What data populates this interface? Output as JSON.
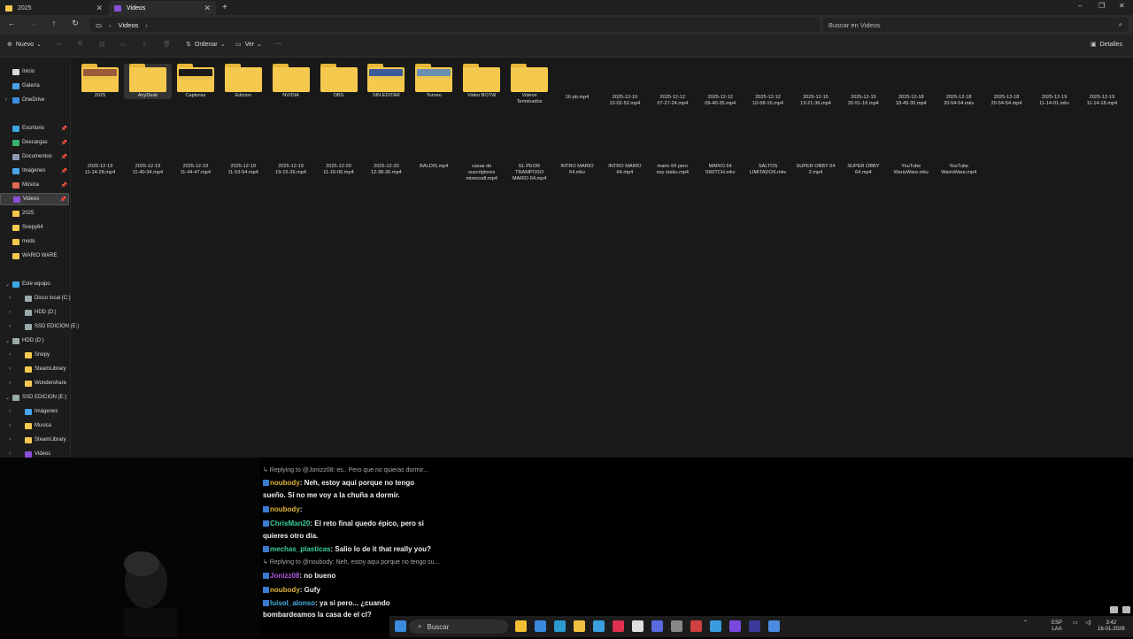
{
  "tabs": [
    {
      "label": "2025",
      "active": false
    },
    {
      "label": "Videos",
      "active": true
    }
  ],
  "window_controls": {
    "minimize": "–",
    "maximize": "❐",
    "close": "✕"
  },
  "address": {
    "path": "Videos",
    "trailing": "›"
  },
  "search": {
    "placeholder": "Buscar en Videos"
  },
  "toolbar": {
    "new_label": "Nuevo",
    "sort_label": "Ordenar",
    "view_label": "Ver",
    "more_label": "···",
    "details_label": "Detalles"
  },
  "sidebar": {
    "items": [
      {
        "label": "Inicio",
        "icon": "home-icon",
        "color": "#d8d8d8",
        "pinned": false
      },
      {
        "label": "Galería",
        "icon": "gallery-icon",
        "color": "#4aa3e8",
        "pinned": false
      },
      {
        "label": "OneDrive",
        "icon": "cloud-icon",
        "color": "#3b8ee0",
        "pinned": false
      },
      {
        "label": "Escritorio",
        "icon": "desktop-icon",
        "color": "#3fa7e6",
        "pinned": true
      },
      {
        "label": "Descargas",
        "icon": "download-icon",
        "color": "#39b36b",
        "pinned": true
      },
      {
        "label": "Documentos",
        "icon": "documents-icon",
        "color": "#8a9bb0",
        "pinned": true
      },
      {
        "label": "Imágenes",
        "icon": "pictures-icon",
        "color": "#4aa3e8",
        "pinned": true
      },
      {
        "label": "Música",
        "icon": "music-icon",
        "color": "#e06a50",
        "pinned": true
      },
      {
        "label": "Videos",
        "icon": "videos-icon",
        "color": "#8b4fd8",
        "pinned": true
      },
      {
        "label": "2025",
        "icon": "folder-icon",
        "color": "#f4c94d",
        "pinned": false
      },
      {
        "label": "Snepy64",
        "icon": "folder-icon",
        "color": "#f4c94d",
        "pinned": false
      },
      {
        "label": "mods",
        "icon": "folder-icon",
        "color": "#f4c94d",
        "pinned": false
      },
      {
        "label": "WARIO WARE",
        "icon": "folder-icon",
        "color": "#f4c94d",
        "pinned": false
      },
      {
        "label": "Este equipo",
        "icon": "pc-icon",
        "color": "#3fa7e6",
        "pinned": false
      },
      {
        "label": "Disco local (C:)",
        "icon": "drive-icon",
        "color": "#9aa",
        "pinned": false
      },
      {
        "label": "HDD (D:)",
        "icon": "drive-icon",
        "color": "#9aa",
        "pinned": false
      },
      {
        "label": "SSD EDICION (E:)",
        "icon": "drive-icon",
        "color": "#9aa",
        "pinned": false
      },
      {
        "label": "HDD (D:)",
        "icon": "drive-icon",
        "color": "#9aa",
        "pinned": false
      },
      {
        "label": "Snepy",
        "icon": "folder-icon",
        "color": "#f4c94d",
        "pinned": false
      },
      {
        "label": "SteamLibrary",
        "icon": "folder-icon",
        "color": "#f4c94d",
        "pinned": false
      },
      {
        "label": "Wondershare",
        "icon": "folder-icon",
        "color": "#f4c94d",
        "pinned": false
      },
      {
        "label": "SSD EDICION (E:)",
        "icon": "drive-icon",
        "color": "#9aa",
        "pinned": false
      },
      {
        "label": "Imágenes",
        "icon": "pictures-icon",
        "color": "#4aa3e8",
        "pinned": false
      },
      {
        "label": "Musica",
        "icon": "folder-icon",
        "color": "#f4c94d",
        "pinned": false
      },
      {
        "label": "SteamLibrary",
        "icon": "folder-icon",
        "color": "#f4c94d",
        "pinned": false
      },
      {
        "label": "Videos",
        "icon": "videos-icon",
        "color": "#8b4fd8",
        "pinned": false
      }
    ]
  },
  "files": [
    {
      "name": "2025",
      "kind": "folder",
      "preview": "#9a5a3a"
    },
    {
      "name": "AnyDesk",
      "kind": "folder",
      "preview": ""
    },
    {
      "name": "Capturas",
      "kind": "folder",
      "preview": "#1a1a1a"
    },
    {
      "name": "Edicion",
      "kind": "folder",
      "preview": ""
    },
    {
      "name": "NVIDIA",
      "kind": "folder",
      "preview": ""
    },
    {
      "name": "OBS",
      "kind": "folder",
      "preview": ""
    },
    {
      "name": "SIN EDITAR",
      "kind": "folder",
      "preview": "#3a5a9a"
    },
    {
      "name": "Torneo",
      "kind": "folder",
      "preview": "#6a8fb0"
    },
    {
      "name": "Video BOTW",
      "kind": "folder",
      "preview": ""
    },
    {
      "name": "Videos\nTerminados",
      "kind": "folder",
      "preview": ""
    },
    {
      "name": "16 pb.mp4",
      "kind": "video",
      "preview": "#c03030"
    },
    {
      "name": "2025-12-10\n12-02-52.mp4",
      "kind": "video",
      "preview": "#e8e4da"
    },
    {
      "name": "2025-12-12\n07-27-24.mp4",
      "kind": "video",
      "preview": "#3a4a8a"
    },
    {
      "name": "2025-12-12\n09-40-35.mp4",
      "kind": "video",
      "preview": "#5a7a2a"
    },
    {
      "name": "2025-12-12\n10-58-16.mp4",
      "kind": "video",
      "preview": "#a8c0d8"
    },
    {
      "name": "2025-12-15\n13-21-36.mp4",
      "kind": "video",
      "preview": "#7a8a7a"
    },
    {
      "name": "2025-12-15\n20-51-16.mp4",
      "kind": "video",
      "preview": "#3a8ad0"
    },
    {
      "name": "2025-12-18\n18-45-30.mp4",
      "kind": "video",
      "preview": "#4a9a3a"
    },
    {
      "name": "2025-12-18\n20-54-54.mkv",
      "kind": "video",
      "preview": "#3a2a4a"
    },
    {
      "name": "2025-12-18\n20-54-54.mp4",
      "kind": "video",
      "preview": "#3a2a4a"
    },
    {
      "name": "2025-12-19\n11-14-01.mkv",
      "kind": "video",
      "preview": "#4aa0d0"
    },
    {
      "name": "2025-12-19\n11-14-18.mp4",
      "kind": "video",
      "preview": "#4aa0d0"
    },
    {
      "name": "2025-12-19\n11-14-28.mp4",
      "kind": "video",
      "preview": "#5a9a4a"
    },
    {
      "name": "2025-12-19\n11-40-34.mp4",
      "kind": "video",
      "preview": "#8a8a8a"
    },
    {
      "name": "2025-12-19\n11-44-47.mp4",
      "kind": "video",
      "preview": "#6a5aa0"
    },
    {
      "name": "2025-12-19\n11-53-54.mp4",
      "kind": "video",
      "preview": "#c0a070"
    },
    {
      "name": "2025-12-19\n19-15-26.mp4",
      "kind": "video",
      "preview": "#d04060"
    },
    {
      "name": "2025-12-20\n11-16-06.mp4",
      "kind": "video",
      "preview": "#4a9a3a"
    },
    {
      "name": "2025-12-20\n12-38-36.mp4",
      "kind": "video",
      "preview": "#050505"
    },
    {
      "name": "BALDIS.mp4",
      "kind": "video",
      "preview": "#d8d8d8"
    },
    {
      "name": "casas de\nsuscriptores\nminecraft.mp4",
      "kind": "video",
      "preview": "#4a5a3a"
    },
    {
      "name": "EL PEOR\nTRAMPOSO\nMARIO 64.mp4",
      "kind": "video",
      "preview": "#2a2a4a"
    },
    {
      "name": "INTRO MARIO\n64.mkv",
      "kind": "video",
      "preview": "#2a2a4a"
    },
    {
      "name": "INTRO MARIO\n64.mp4",
      "kind": "video",
      "preview": "#2a2a4a"
    },
    {
      "name": "mario 64 pero\nsoy otaku.mp4",
      "kind": "video",
      "preview": "#d0b030"
    },
    {
      "name": "MARIO 64\nSWITCH.mkv",
      "kind": "video",
      "preview": "#e0d8c8"
    },
    {
      "name": "SALTOS\nLIMITADOS.mkv",
      "kind": "video",
      "preview": "#0a0a0a"
    },
    {
      "name": "SUPER OBBY 64\n2.mp4",
      "kind": "video",
      "preview": "#c03060"
    },
    {
      "name": "SUPER OBBY\n64.mp4",
      "kind": "video",
      "preview": "#303a5a"
    },
    {
      "name": "YouTube\nWarioWare.mkv",
      "kind": "video",
      "preview": "#c05a20"
    },
    {
      "name": "YouTube\nWarioWare.mp4",
      "kind": "video",
      "preview": "#c05a20"
    }
  ],
  "chat": {
    "messages": [
      {
        "user": "",
        "text": "↳ Replying to @Jonizz08: es.. Pero que no quieras dormir...",
        "user_color": "#aaa",
        "small": true
      },
      {
        "user": "noubody",
        "text": "Neh, estoy aqui porque no tengo",
        "user_color": "#e0b43a",
        "small": false
      },
      {
        "user": "",
        "text": "sueño. Si no me voy a la chuña a dormir.",
        "user_color": "#eee",
        "small": false
      },
      {
        "user": "noubody",
        "text": "",
        "user_color": "#e0b43a",
        "small": false
      },
      {
        "user": "ChrisMan20",
        "text": "El reto final quedo épico, pero si",
        "user_color": "#3ad0a0",
        "small": false
      },
      {
        "user": "",
        "text": "quieres otro día.",
        "user_color": "#eee",
        "small": false
      },
      {
        "user": "mechas_plasticas",
        "text": "Salio lo de it that really you?",
        "user_color": "#3ad0a0",
        "small": false
      },
      {
        "user": "",
        "text": "↳ Replying to @noubody: Neh, estoy aqui porque no tengo su...",
        "user_color": "#aaa",
        "small": true
      },
      {
        "user": "Jonizz08",
        "text": "no bueno",
        "user_color": "#b05ae0",
        "small": false
      },
      {
        "user": "noubody",
        "text": "Gufy",
        "user_color": "#e0b43a",
        "small": false
      },
      {
        "user": "luisol_alonso",
        "text": "ya si pero... ¿cuando",
        "user_color": "#4ab0e0",
        "small": false
      },
      {
        "user": "",
        "text": "bombardeamos la casa de el cl?",
        "user_color": "#eee",
        "small": false
      }
    ]
  },
  "taskbar": {
    "search_label": "Buscar",
    "lang": "ESP",
    "lang2": "LAA",
    "time": "3:42",
    "date": "16-01-2026",
    "app_colors": [
      "#f0c030",
      "#3a8ae0",
      "#2a9ad0",
      "#f0c040",
      "#3aa0e0",
      "#e03050",
      "#e0e0e0",
      "#5a6ae0",
      "#888",
      "#d04040",
      "#3a9ae0",
      "#7a4ae0",
      "#3a3a9a",
      "#4a8ae0"
    ]
  }
}
